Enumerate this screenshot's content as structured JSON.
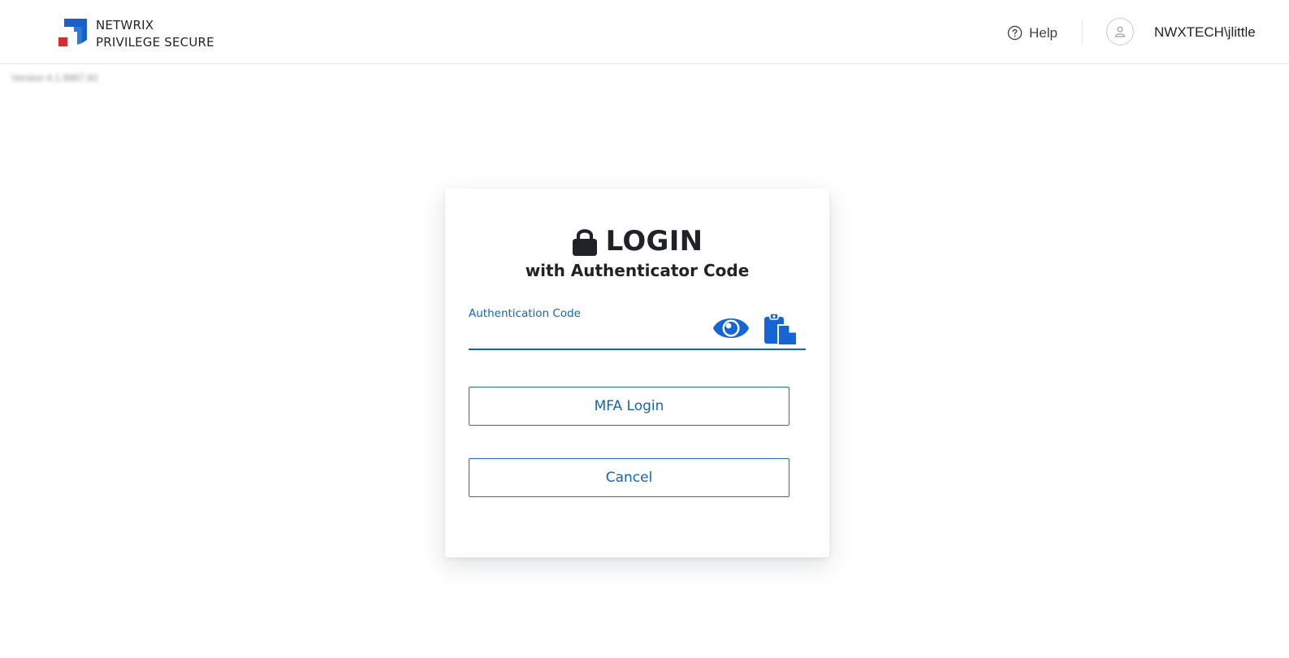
{
  "app": {
    "brand_line1": "NETWRIX",
    "brand_line2": "PRIVILEGE SECURE",
    "version_text": "Version 4.1.9967.92",
    "colors": {
      "primary": "#1565b7",
      "brand_blue": "#1b5fc9",
      "brand_red": "#d32f2f",
      "text": "#1f2328"
    }
  },
  "header": {
    "help_label": "Help",
    "help_icon": "help-circle-icon",
    "user_icon": "user-avatar-icon",
    "username": "NWXTECH\\jlittle"
  },
  "login": {
    "lock_icon": "lock-icon",
    "title": "LOGIN",
    "subtitle": "with Authenticator Code",
    "field_label": "Authentication Code",
    "field_value": "",
    "show_icon": "eye-icon",
    "paste_icon": "clipboard-paste-icon",
    "mfa_button": "MFA Login",
    "cancel_button": "Cancel"
  }
}
